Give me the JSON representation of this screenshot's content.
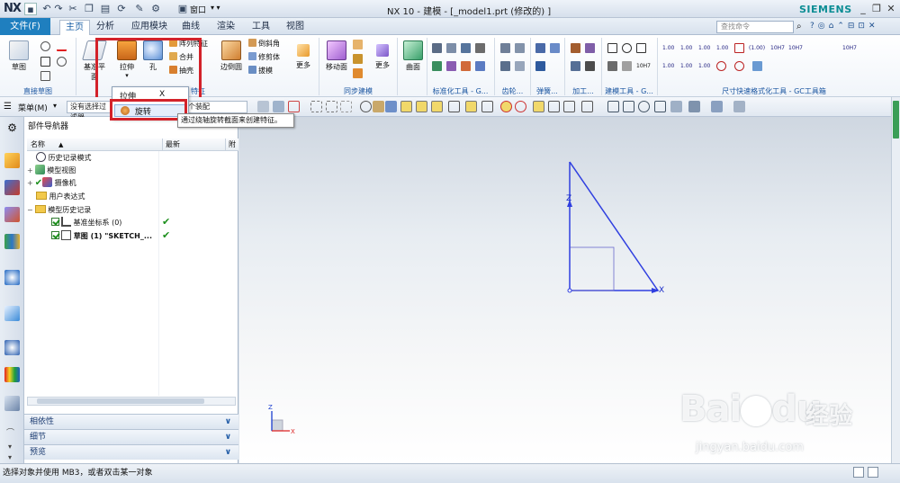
{
  "app": {
    "logo": "NX",
    "window_title": "NX 10 - 建模 - [_model1.prt  (修改的) ]",
    "brand": "SIEMENS",
    "window_menu": "窗口"
  },
  "tabs": [
    {
      "label": "文件(F)"
    },
    {
      "label": "主页"
    },
    {
      "label": "分析"
    },
    {
      "label": "应用模块"
    },
    {
      "label": "曲线"
    },
    {
      "label": "渲染"
    },
    {
      "label": "工具"
    },
    {
      "label": "视图"
    }
  ],
  "search": {
    "placeholder": "查找命令"
  },
  "ribbon": {
    "sketch": {
      "label": "草图"
    },
    "datum_plane": {
      "label": "基准平面"
    },
    "extrude": {
      "label": "拉伸"
    },
    "hole": {
      "label": "孔"
    },
    "pattern_feature": {
      "label": "阵列特征"
    },
    "unite": {
      "label": "合并"
    },
    "shell": {
      "label": "抽壳"
    },
    "edge_blend": {
      "label": "边倒圆"
    },
    "chamfer": {
      "label": "倒斜角"
    },
    "trim_body": {
      "label": "修剪体"
    },
    "draft": {
      "label": "拔模"
    },
    "more1": {
      "label": "更多"
    },
    "move_face": {
      "label": "移动面"
    },
    "more2": {
      "label": "更多"
    },
    "surface": {
      "label": "曲面"
    },
    "dim_labels": [
      "1.00",
      "1.00",
      "1.00",
      "1.00",
      "(1.00)",
      "10H7",
      "10H7"
    ],
    "dim_labels2": [
      "1.00",
      "1.00",
      "1.00",
      "10H7"
    ],
    "groups": {
      "direct_sketch": "直接草图",
      "feature": "特征",
      "sync_modeling": "同步建模",
      "std_tools": "标准化工具 - G...",
      "edge": "齿轮...",
      "spring": "弹簧...",
      "machining": "加工...",
      "build_tools": "建模工具 - G...",
      "dim_quick": "尺寸快速格式化工具 - GC工具箱"
    }
  },
  "cmdbar": {
    "menu": "菜单(M)",
    "filter": "没有选择过滤器",
    "assembly": "整个装配"
  },
  "dropdown": {
    "items": [
      {
        "label": "拉伸"
      },
      {
        "label": "旋转"
      }
    ],
    "close": "X"
  },
  "tooltip": "通过绕轴旋转截面来创建特征。",
  "navigator": {
    "title": "部件导航器",
    "columns": {
      "name": "名称",
      "latest": "最新",
      "extra": "附"
    },
    "rows": [
      {
        "label": "历史记录模式"
      },
      {
        "label": "模型视图"
      },
      {
        "label": "摄像机"
      },
      {
        "label": "用户表达式"
      },
      {
        "label": "模型历史记录"
      },
      {
        "label": "基准坐标系 (0)"
      },
      {
        "label": "草图 (1) \"SKETCH_..."
      }
    ],
    "panels": [
      {
        "label": "相依性"
      },
      {
        "label": "细节"
      },
      {
        "label": "预览"
      }
    ]
  },
  "sketch": {
    "axis_z": "Z",
    "axis_x": "X",
    "triad_z": "Z",
    "triad_x": "X"
  },
  "status": "选择对象并使用 MB3，或者双击某一对象",
  "watermark": {
    "brand": "Bai",
    "brand2": "du",
    "cn": "经验",
    "url": "jingyan.baidu.com"
  },
  "colors": {
    "accent": "#1f7fbf",
    "sketch_blue": "#2f3fe0",
    "highlight": "#d3222a",
    "check": "#1d8f1d"
  }
}
